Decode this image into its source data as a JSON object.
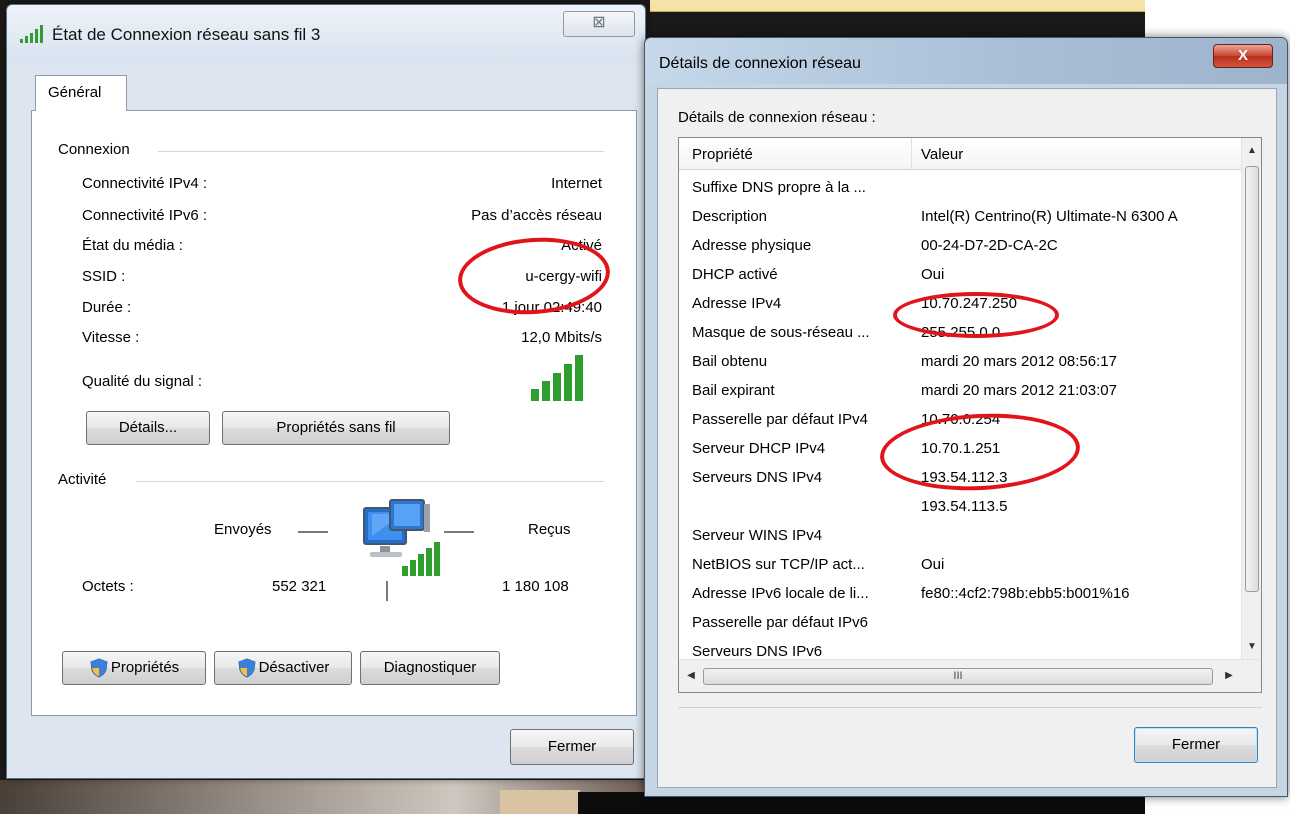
{
  "status_window": {
    "title": "État de Connexion réseau sans fil 3",
    "close_glyph": "⊠",
    "tab": "Général",
    "connection": {
      "group_label": "Connexion",
      "rows": [
        {
          "label": "Connectivité IPv4 :",
          "value": "Internet"
        },
        {
          "label": "Connectivité IPv6 :",
          "value": "Pas d’accès réseau"
        },
        {
          "label": "État du média :",
          "value": "Activé"
        },
        {
          "label": "SSID :",
          "value": "u-cergy-wifi"
        },
        {
          "label": "Durée :",
          "value": "1 jour 02:49:40"
        },
        {
          "label": "Vitesse :",
          "value": "12,0 Mbits/s"
        }
      ],
      "signal_label": "Qualité du signal :",
      "signal_bars_lit": 5,
      "signal_bars_total": 5
    },
    "buttons": {
      "details": "Détails...",
      "wireless_props": "Propriétés sans fil",
      "properties": "Propriétés",
      "disable": "Désactiver",
      "diagnose": "Diagnostiquer",
      "close": "Fermer"
    },
    "activity": {
      "group_label": "Activité",
      "sent_label": "Envoyés",
      "received_label": "Reçus",
      "bytes_label": "Octets :",
      "bytes_sent": "552 321",
      "bytes_received": "1 180 108"
    }
  },
  "details_window": {
    "title": "Détails de connexion réseau",
    "close_glyph": "X",
    "section_label": "Détails de connexion réseau :",
    "columns": {
      "property": "Propriété",
      "value": "Valeur"
    },
    "rows": [
      {
        "property": "Suffixe DNS propre à la ...",
        "value": ""
      },
      {
        "property": "Description",
        "value": "Intel(R) Centrino(R) Ultimate-N 6300 A"
      },
      {
        "property": "Adresse physique",
        "value": "00-24-D7-2D-CA-2C"
      },
      {
        "property": "DHCP activé",
        "value": "Oui"
      },
      {
        "property": "Adresse IPv4",
        "value": "10.70.247.250"
      },
      {
        "property": "Masque de sous-réseau ...",
        "value": "255.255.0.0"
      },
      {
        "property": "Bail obtenu",
        "value": "mardi 20 mars 2012 08:56:17"
      },
      {
        "property": "Bail expirant",
        "value": "mardi 20 mars 2012 21:03:07"
      },
      {
        "property": "Passerelle par défaut IPv4",
        "value": "10.70.0.254"
      },
      {
        "property": "Serveur DHCP IPv4",
        "value": "10.70.1.251"
      },
      {
        "property": "Serveurs DNS IPv4",
        "value": "193.54.112.3"
      },
      {
        "property": "",
        "value": "193.54.113.5"
      },
      {
        "property": "Serveur WINS IPv4",
        "value": ""
      },
      {
        "property": "NetBIOS sur TCP/IP act...",
        "value": "Oui"
      },
      {
        "property": "Adresse IPv6 locale de li...",
        "value": "fe80::4cf2:798b:ebb5:b001%16"
      },
      {
        "property": "Passerelle par défaut IPv6",
        "value": ""
      },
      {
        "property": "Serveurs DNS IPv6",
        "value": ""
      }
    ],
    "hscroll_grip": "III",
    "close_button": "Fermer"
  },
  "colors": {
    "annotation": "#e0141a",
    "signal": "#2e9e2e"
  }
}
